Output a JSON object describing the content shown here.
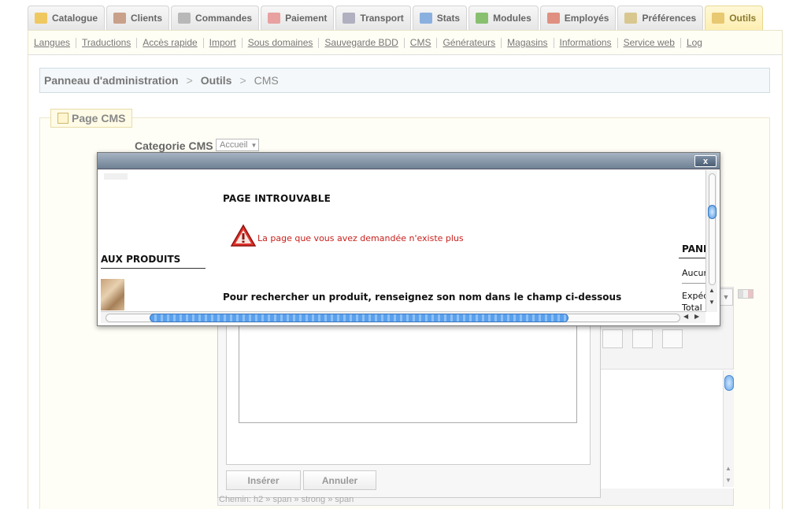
{
  "tabs": [
    {
      "label": "Catalogue",
      "icon": "folder-icon",
      "color": "#f0c860"
    },
    {
      "label": "Clients",
      "icon": "user-icon",
      "color": "#c9a08a"
    },
    {
      "label": "Commandes",
      "icon": "cart-icon",
      "color": "#b8b8b8"
    },
    {
      "label": "Paiement",
      "icon": "payment-icon",
      "color": "#e8a0a0"
    },
    {
      "label": "Transport",
      "icon": "truck-icon",
      "color": "#b0b0c0"
    },
    {
      "label": "Stats",
      "icon": "chart-icon",
      "color": "#8ab0e0"
    },
    {
      "label": "Modules",
      "icon": "puzzle-icon",
      "color": "#88c070"
    },
    {
      "label": "Employés",
      "icon": "employee-icon",
      "color": "#e09080"
    },
    {
      "label": "Préférences",
      "icon": "preferences-icon",
      "color": "#d8c890"
    },
    {
      "label": "Outils",
      "icon": "tools-icon",
      "color": "#e8c870"
    }
  ],
  "subnav": [
    "Langues",
    "Traductions",
    "Accès rapide",
    "Import",
    "Sous domaines",
    "Sauvegarde BDD",
    "CMS",
    "Générateurs",
    "Magasins",
    "Informations",
    "Service web",
    "Log"
  ],
  "breadcrumb": {
    "item1": "Panneau d'administration",
    "item2": "Outils",
    "item3": "CMS",
    "sep": ">"
  },
  "form": {
    "legend": "Page CMS",
    "category_label": "Categorie CMS",
    "category_value": "Accueil"
  },
  "dialog": {
    "insert_label": "Insérer",
    "cancel_label": "Annuler",
    "path_text": "Chemin: h2 » span » strong » span"
  },
  "popup": {
    "close_label": "x",
    "title": "PAGE INTROUVABLE",
    "message": "La page que vous avez demandée n'existe plus",
    "left_heading": "AUX PRODUITS",
    "bottom_text": "Pour rechercher un produit, renseignez son nom dans le champ ci-dessous",
    "right_heading": "PANI",
    "right_line1": "Aucur",
    "right_line2": "Expéd",
    "right_line3": "Total"
  }
}
